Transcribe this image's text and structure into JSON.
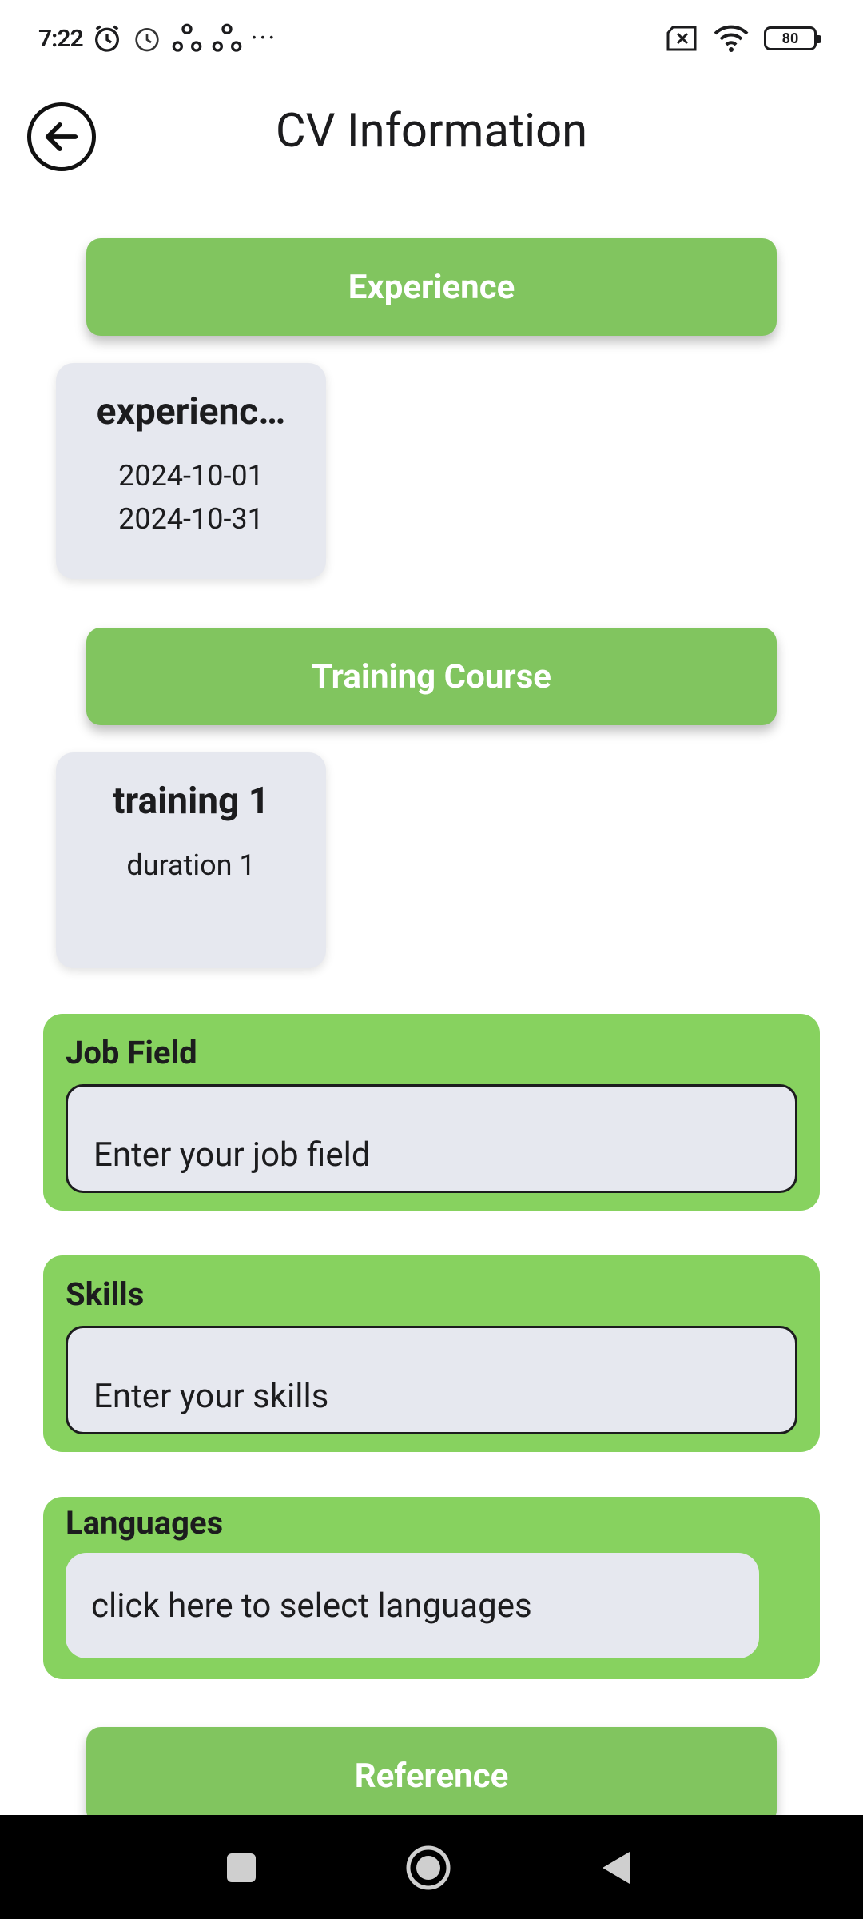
{
  "status": {
    "time": "7:22",
    "icons": [
      "alarm-icon",
      "alarm-outline-icon",
      "sync-icon",
      "sync-icon",
      "more-icon"
    ],
    "battery_level": "80"
  },
  "header": {
    "title": "CV Information",
    "back_icon": "arrow-left-circle-icon"
  },
  "experience": {
    "button_label": "Experience",
    "card": {
      "title": "experienc…",
      "start_date": "2024-10-01",
      "end_date": "2024-10-31"
    }
  },
  "training": {
    "button_label": "Training Course",
    "card": {
      "title": "training 1",
      "duration": "duration 1"
    }
  },
  "job_field": {
    "label": "Job Field",
    "placeholder": "Enter your job field",
    "value": ""
  },
  "skills": {
    "label": "Skills",
    "placeholder": "Enter your skills",
    "value": ""
  },
  "languages": {
    "label": "Languages",
    "select_text": "click here to select languages"
  },
  "reference": {
    "button_label": "Reference"
  },
  "colors": {
    "section_button": "#81c55f",
    "field_group": "#87d25f",
    "card_bg": "#e6e8ef",
    "navbar": "#000000"
  }
}
